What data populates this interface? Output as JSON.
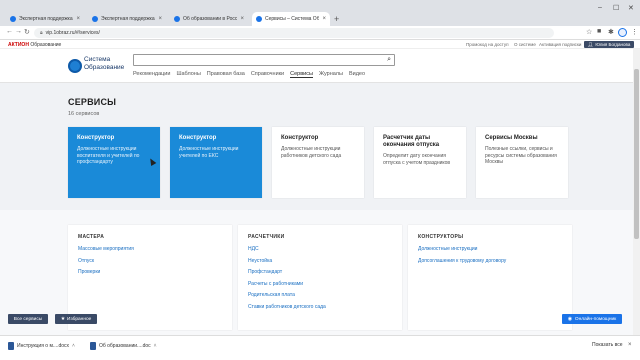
{
  "browser": {
    "tabs": [
      {
        "label": "Экспертная поддержка – Систе",
        "close": "×"
      },
      {
        "label": "Экспертная поддержка – Систе",
        "close": "×"
      },
      {
        "label": "Об образовании в Российской",
        "close": "×"
      },
      {
        "label": "Сервисы – Система Образова",
        "close": "×"
      }
    ],
    "new_tab": "+",
    "url": "vip.1obraz.ru/#/services/"
  },
  "topstrip": {
    "brand": "АКТИОН",
    "brand_suffix": "Образование",
    "links": [
      "Промокод на доступ",
      "О системе",
      "Активация подписки"
    ],
    "login_label": "Юлия Богданова"
  },
  "header": {
    "logo_text": "Система\nОбразование",
    "search_placeholder": "",
    "nav": [
      "Рекомендации",
      "Шаблоны",
      "Правовая база",
      "Справочники",
      "Сервисы",
      "Журналы",
      "Видео"
    ],
    "nav_active_index": 4
  },
  "page": {
    "title": "СЕРВИСЫ",
    "count": "16 сервисов"
  },
  "cards": [
    {
      "title": "Конструктор",
      "desc": "Должностные инструкции воспитателя и учителей по профстандарту",
      "style": "blue"
    },
    {
      "title": "Конструктор",
      "desc": "Должностные инструкции учителей по ЕКС",
      "style": "blue"
    },
    {
      "title": "Конструктор",
      "desc": "Должностные инструкции работников детского сада",
      "style": "white"
    },
    {
      "title": "Расчетчик даты окончания отпуска",
      "desc": "Определит дату окончания отпуска с учетом праздников",
      "style": "white"
    },
    {
      "title": "Сервисы Москвы",
      "desc": "Полезные ссылки, сервисы и ресурсы системы образования Москвы",
      "style": "white"
    }
  ],
  "panels": [
    {
      "heading": "МАСТЕРА",
      "links": [
        "Массовые мероприятия",
        "Отпуск",
        "Проверки"
      ]
    },
    {
      "heading": "РАСЧЕТЧИКИ",
      "links": [
        "НДС",
        "Неустойка",
        "Профстандарт",
        "Расчеты с работниками",
        "Родительская плата",
        "Ставки работников детского сада"
      ]
    },
    {
      "heading": "КОНСТРУКТОРЫ",
      "links": [
        "Должностные инструкции",
        "Допсоглашения к трудовому договору"
      ]
    }
  ],
  "footer_buttons": {
    "all_services": "Все сервисы",
    "favorites": "Избранное",
    "help": "Онлайн-помощник"
  },
  "downloads": {
    "items": [
      {
        "name": "Инструкция о м....docx"
      },
      {
        "name": "Об образовании....doc"
      }
    ],
    "show_all": "Показать все",
    "close": "×"
  },
  "colors": {
    "accent_blue": "#1a8ad8",
    "dark_button": "#3a4a66",
    "brand_red": "#cc0000"
  }
}
